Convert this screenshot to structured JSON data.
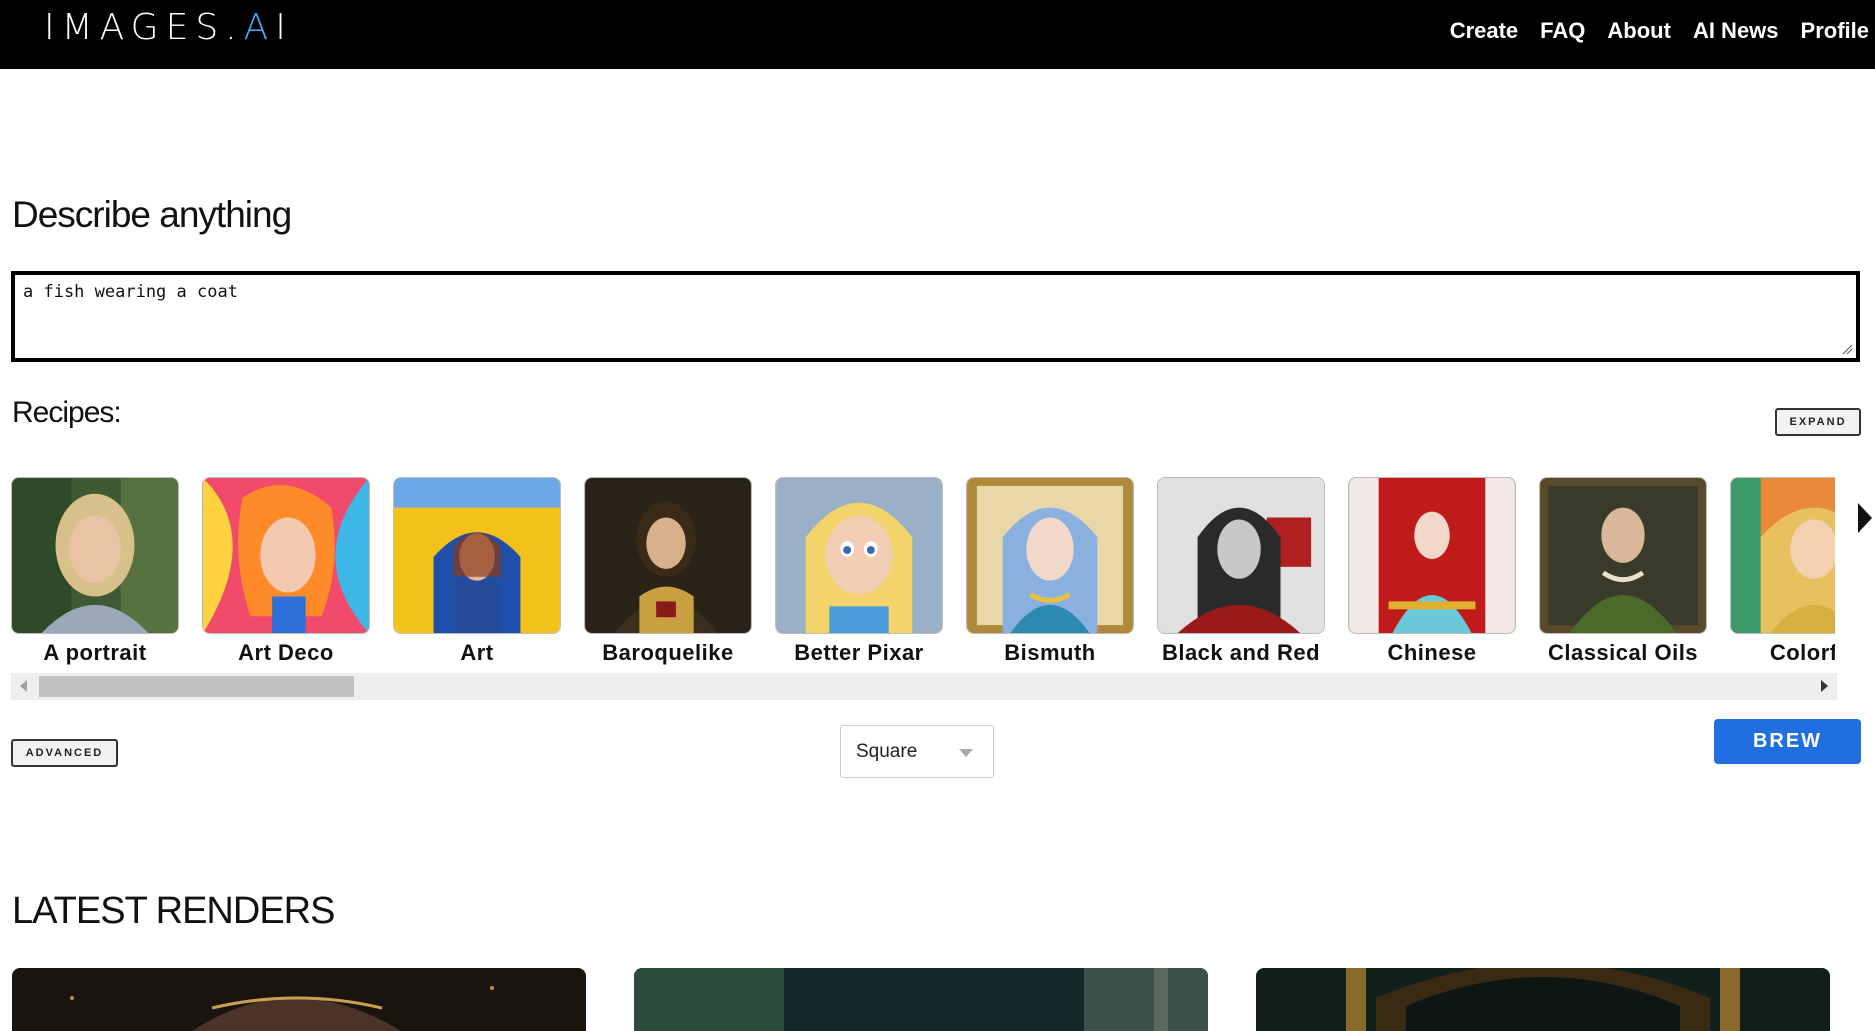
{
  "nav": {
    "logo": "IMAGES.AI",
    "links": [
      "Create",
      "FAQ",
      "About",
      "AI News",
      "Profile"
    ]
  },
  "describe": {
    "title": "Describe anything",
    "prompt_value": "a fish wearing a coat"
  },
  "recipes": {
    "title": "Recipes:",
    "expand_label": "EXPAND",
    "items": [
      {
        "label": "A portrait"
      },
      {
        "label": "Art Deco"
      },
      {
        "label": "Art"
      },
      {
        "label": "Baroquelike"
      },
      {
        "label": "Better Pixar"
      },
      {
        "label": "Bismuth"
      },
      {
        "label": "Black and Red"
      },
      {
        "label": "Chinese"
      },
      {
        "label": "Classical Oils"
      },
      {
        "label": "Colorful"
      }
    ]
  },
  "controls": {
    "advanced_label": "ADVANCED",
    "aspect_selected": "Square",
    "brew_label": "BREW"
  },
  "latest": {
    "title": "LATEST RENDERS"
  },
  "colors": {
    "nav_bg": "#000000",
    "accent": "#1f6fe0"
  }
}
